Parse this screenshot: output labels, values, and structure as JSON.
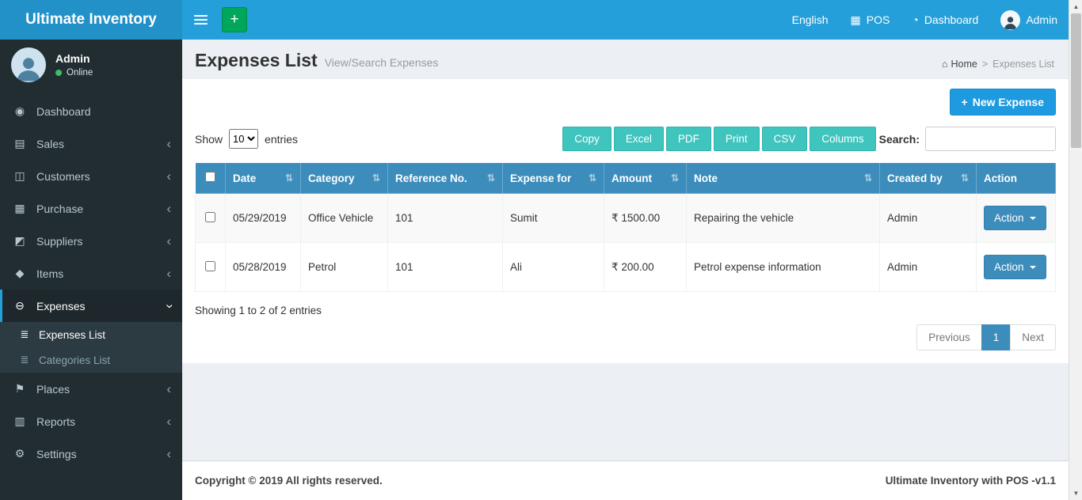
{
  "brand": {
    "title": "Ultimate Inventory"
  },
  "topbar": {
    "language": "English",
    "pos": "POS",
    "dashboard": "Dashboard",
    "user": "Admin"
  },
  "sidebar": {
    "user_name": "Admin",
    "user_status": "Online",
    "items": [
      {
        "label": "Dashboard"
      },
      {
        "label": "Sales"
      },
      {
        "label": "Customers"
      },
      {
        "label": "Purchase"
      },
      {
        "label": "Suppliers"
      },
      {
        "label": "Items"
      },
      {
        "label": "Expenses"
      },
      {
        "label": "Places"
      },
      {
        "label": "Reports"
      },
      {
        "label": "Settings"
      }
    ],
    "expenses_submenu": [
      {
        "label": "Expenses List"
      },
      {
        "label": "Categories List"
      }
    ]
  },
  "page": {
    "title": "Expenses List",
    "subtitle": "View/Search Expenses",
    "breadcrumb_home": "Home",
    "breadcrumb_sep": ">",
    "breadcrumb_current": "Expenses List"
  },
  "toolbar": {
    "new_expense_label": "New Expense",
    "show_label": "Show",
    "entries_value": "10",
    "entries_label": "entries",
    "buttons": [
      "Copy",
      "Excel",
      "PDF",
      "Print",
      "CSV",
      "Columns"
    ],
    "search_label": "Search:"
  },
  "table": {
    "headers": [
      "Date",
      "Category",
      "Reference No.",
      "Expense for",
      "Amount",
      "Note",
      "Created by",
      "Action"
    ],
    "rows": [
      {
        "date": "05/29/2019",
        "category": "Office Vehicle",
        "reference": "101",
        "expense_for": "Sumit",
        "amount": "₹ 1500.00",
        "note": "Repairing the vehicle",
        "created_by": "Admin",
        "action": "Action"
      },
      {
        "date": "05/28/2019",
        "category": "Petrol",
        "reference": "101",
        "expense_for": "Ali",
        "amount": "₹ 200.00",
        "note": "Petrol expense information",
        "created_by": "Admin",
        "action": "Action"
      }
    ],
    "info": "Showing 1 to 2 of 2 entries"
  },
  "pagination": {
    "previous": "Previous",
    "page": "1",
    "next": "Next"
  },
  "footer": {
    "left": "Copyright © 2019 All rights reserved.",
    "right": "Ultimate Inventory with POS -v1.1"
  },
  "icons": {
    "plus": "+",
    "pos": "▦",
    "dashboard_top": "◔",
    "home": "⌂",
    "dashboard": "◉",
    "sales": "▤",
    "customers": "◫",
    "purchase": "▦",
    "suppliers": "◩",
    "items": "◆",
    "expenses": "⊖",
    "list": "≣",
    "places": "⚑",
    "reports": "▥",
    "settings": "⚙",
    "chevron": "‹",
    "sort": "⇅"
  },
  "colors": {
    "navbar": "#259fd9",
    "logo-bg": "#2291c8",
    "green": "#00a65a",
    "primary": "#3c8dbc",
    "dt-button": "#40c4be",
    "new-expense": "#1e9be0",
    "sidebar-bg": "#222d32",
    "sidebar-active": "#1e282c",
    "submenu-bg": "#2c3b41",
    "content-bg": "#ecf0f5",
    "online-green": "#3dbd64"
  }
}
